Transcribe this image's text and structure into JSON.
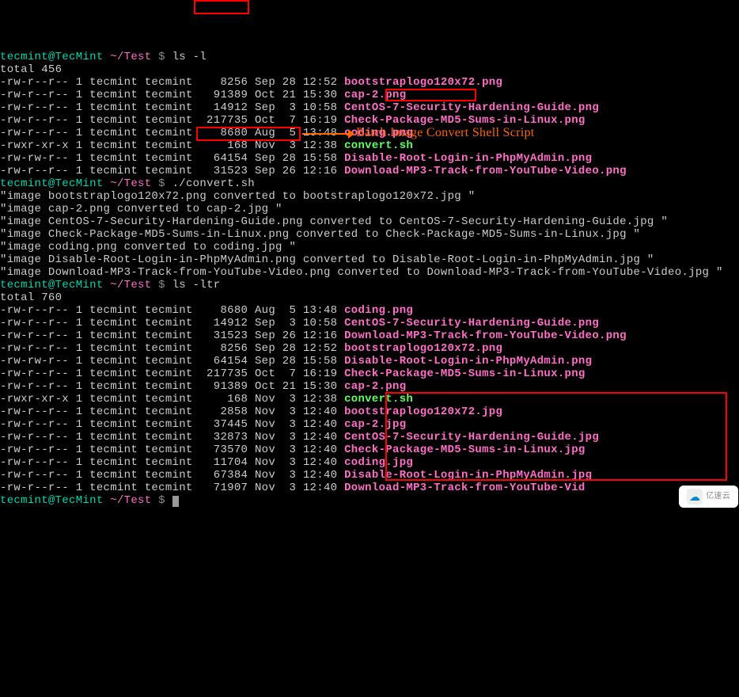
{
  "prompt": {
    "user": "tecmint@TecMint",
    "path_prefix": " ~",
    "dir": "/Test",
    "sep": " $ "
  },
  "commands": {
    "ls_l": "ls -l",
    "convert": "./convert.sh",
    "ls_ltr": "ls -ltr"
  },
  "annotation": "Batch Image Convert Shell Script",
  "listing1_total": "total 456",
  "listing1": [
    {
      "perms": "-rw-r--r-- 1 tecmint tecmint    8256 Sep 28 12:52 ",
      "file": "bootstraplogo120x72.png",
      "cls": "filename-pink"
    },
    {
      "perms": "-rw-r--r-- 1 tecmint tecmint   91389 Oct 21 15:30 ",
      "file": "cap-2.png",
      "cls": "filename-pink"
    },
    {
      "perms": "-rw-r--r-- 1 tecmint tecmint   14912 Sep  3 10:58 ",
      "file": "CentOS-7-Security-Hardening-Guide.png",
      "cls": "filename-pink"
    },
    {
      "perms": "-rw-r--r-- 1 tecmint tecmint  217735 Oct  7 16:19 ",
      "file": "Check-Package-MD5-Sums-in-Linux.png",
      "cls": "filename-pink"
    },
    {
      "perms": "-rw-r--r-- 1 tecmint tecmint    8680 Aug  5 13:48 ",
      "file": "coding.png",
      "cls": "filename-pink"
    },
    {
      "perms": "-rwxr-xr-x 1 tecmint tecmint     168 Nov  3 12:38 ",
      "file": "convert.sh",
      "cls": "filename-green"
    },
    {
      "perms": "-rw-rw-r-- 1 tecmint tecmint   64154 Sep 28 15:58 ",
      "file": "Disable-Root-Login-in-PhpMyAdmin.png",
      "cls": "filename-pink"
    },
    {
      "perms": "-rw-r--r-- 1 tecmint tecmint   31523 Sep 26 12:16 ",
      "file": "Download-MP3-Track-from-YouTube-Video.png",
      "cls": "filename-pink"
    }
  ],
  "script_output": [
    "\"image bootstraplogo120x72.png converted to bootstraplogo120x72.jpg \"",
    "\"image cap-2.png converted to cap-2.jpg \"",
    "\"image CentOS-7-Security-Hardening-Guide.png converted to CentOS-7-Security-Hardening-Guide.jpg \"",
    "\"image Check-Package-MD5-Sums-in-Linux.png converted to Check-Package-MD5-Sums-in-Linux.jpg \"",
    "\"image coding.png converted to coding.jpg \"",
    "\"image Disable-Root-Login-in-PhpMyAdmin.png converted to Disable-Root-Login-in-PhpMyAdmin.jpg \"",
    "\"image Download-MP3-Track-from-YouTube-Video.png converted to Download-MP3-Track-from-YouTube-Video.jpg \""
  ],
  "listing2_total": "total 760",
  "listing2": [
    {
      "perms": "-rw-r--r-- 1 tecmint tecmint    8680 Aug  5 13:48 ",
      "file": "coding.png",
      "cls": "filename-pink"
    },
    {
      "perms": "-rw-r--r-- 1 tecmint tecmint   14912 Sep  3 10:58 ",
      "file": "CentOS-7-Security-Hardening-Guide.png",
      "cls": "filename-pink"
    },
    {
      "perms": "-rw-r--r-- 1 tecmint tecmint   31523 Sep 26 12:16 ",
      "file": "Download-MP3-Track-from-YouTube-Video.png",
      "cls": "filename-pink"
    },
    {
      "perms": "-rw-r--r-- 1 tecmint tecmint    8256 Sep 28 12:52 ",
      "file": "bootstraplogo120x72.png",
      "cls": "filename-pink"
    },
    {
      "perms": "-rw-rw-r-- 1 tecmint tecmint   64154 Sep 28 15:58 ",
      "file": "Disable-Root-Login-in-PhpMyAdmin.png",
      "cls": "filename-pink"
    },
    {
      "perms": "-rw-r--r-- 1 tecmint tecmint  217735 Oct  7 16:19 ",
      "file": "Check-Package-MD5-Sums-in-Linux.png",
      "cls": "filename-pink"
    },
    {
      "perms": "-rw-r--r-- 1 tecmint tecmint   91389 Oct 21 15:30 ",
      "file": "cap-2.png",
      "cls": "filename-pink"
    },
    {
      "perms": "-rwxr-xr-x 1 tecmint tecmint     168 Nov  3 12:38 ",
      "file": "convert.sh",
      "cls": "filename-green"
    },
    {
      "perms": "-rw-r--r-- 1 tecmint tecmint    2858 Nov  3 12:40 ",
      "file": "bootstraplogo120x72.jpg",
      "cls": "filename-pink"
    },
    {
      "perms": "-rw-r--r-- 1 tecmint tecmint   37445 Nov  3 12:40 ",
      "file": "cap-2.jpg",
      "cls": "filename-pink"
    },
    {
      "perms": "-rw-r--r-- 1 tecmint tecmint   32873 Nov  3 12:40 ",
      "file": "CentOS-7-Security-Hardening-Guide.jpg",
      "cls": "filename-pink"
    },
    {
      "perms": "-rw-r--r-- 1 tecmint tecmint   73570 Nov  3 12:40 ",
      "file": "Check-Package-MD5-Sums-in-Linux.jpg",
      "cls": "filename-pink"
    },
    {
      "perms": "-rw-r--r-- 1 tecmint tecmint   11704 Nov  3 12:40 ",
      "file": "coding.jpg",
      "cls": "filename-pink"
    },
    {
      "perms": "-rw-r--r-- 1 tecmint tecmint   67384 Nov  3 12:40 ",
      "file": "Disable-Root-Login-in-PhpMyAdmin.jpg",
      "cls": "filename-pink"
    },
    {
      "perms": "-rw-r--r-- 1 tecmint tecmint   71907 Nov  3 12:40 ",
      "file": "Download-MP3-Track-from-YouTube-Vid",
      "cls": "filename-pink"
    }
  ],
  "watermark": "亿速云"
}
